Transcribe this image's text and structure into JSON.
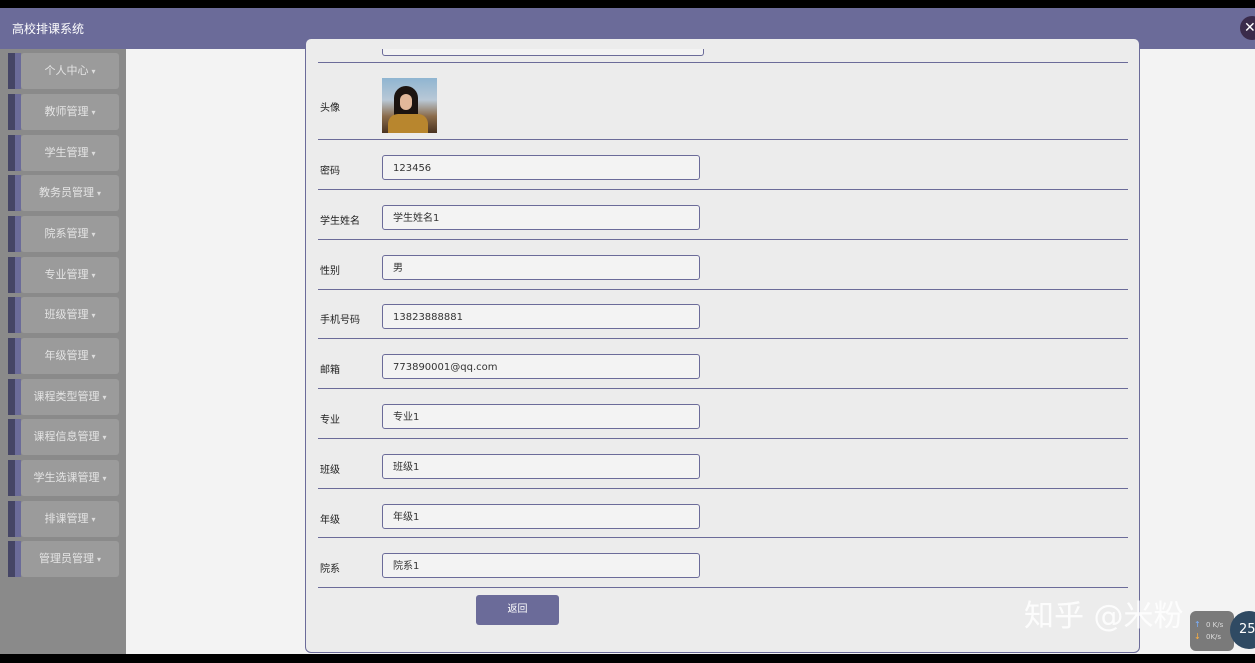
{
  "header": {
    "app_title": "高校排课系统",
    "close_icon": "close-icon"
  },
  "sidebar": {
    "items": [
      {
        "label": "个人中心"
      },
      {
        "label": "教师管理"
      },
      {
        "label": "学生管理"
      },
      {
        "label": "教务员管理"
      },
      {
        "label": "院系管理"
      },
      {
        "label": "专业管理"
      },
      {
        "label": "班级管理"
      },
      {
        "label": "年级管理"
      },
      {
        "label": "课程类型管理"
      },
      {
        "label": "课程信息管理"
      },
      {
        "label": "学生选课管理"
      },
      {
        "label": "排课管理"
      },
      {
        "label": "管理员管理"
      }
    ],
    "caret_glyph": "▾"
  },
  "form": {
    "avatar_label": "头像",
    "fields": [
      {
        "label": "密码",
        "value": "123456"
      },
      {
        "label": "学生姓名",
        "value": "学生姓名1"
      },
      {
        "label": "性别",
        "value": "男"
      },
      {
        "label": "手机号码",
        "value": "13823888881"
      },
      {
        "label": "邮箱",
        "value": "773890001@qq.com"
      },
      {
        "label": "专业",
        "value": "专业1"
      },
      {
        "label": "班级",
        "value": "班级1"
      },
      {
        "label": "年级",
        "value": "年级1"
      },
      {
        "label": "院系",
        "value": "院系1"
      }
    ],
    "return_label": "返回"
  },
  "overlay": {
    "watermark": "知乎 @米粉",
    "net_up": "0 K/s",
    "net_down": "0K/s",
    "cpu": "25"
  },
  "colors": {
    "accent": "#6b6b99",
    "sidebar_bg": "#8a8a8a",
    "panel_bg": "#ececec"
  }
}
